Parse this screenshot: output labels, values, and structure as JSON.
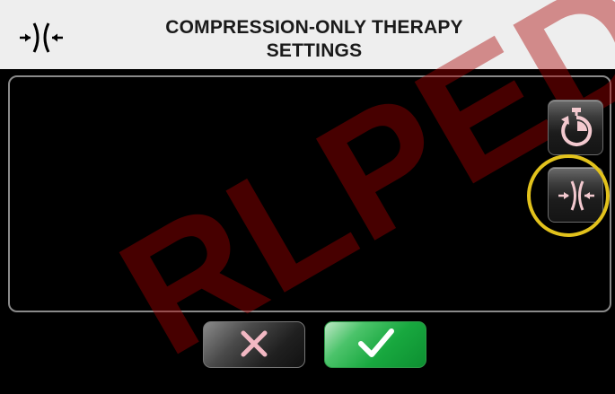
{
  "header": {
    "title_line1": "COMPRESSION-ONLY THERAPY",
    "title_line2": "SETTINGS",
    "icon": "compression-icon"
  },
  "side_buttons": [
    {
      "icon": "stopwatch-reset-icon"
    },
    {
      "icon": "compression-icon",
      "highlighted": true
    }
  ],
  "footer_buttons": [
    {
      "icon": "close-icon"
    },
    {
      "icon": "checkmark-icon"
    }
  ],
  "watermark": "RLPED",
  "colors": {
    "header_bg": "#eeeeee",
    "highlight_ring": "#e2c21c",
    "icon_pink": "#f3c9cf",
    "cancel_x": "#f2b8c3",
    "confirm_bg": "#18a83f",
    "watermark": "#aa0000"
  }
}
